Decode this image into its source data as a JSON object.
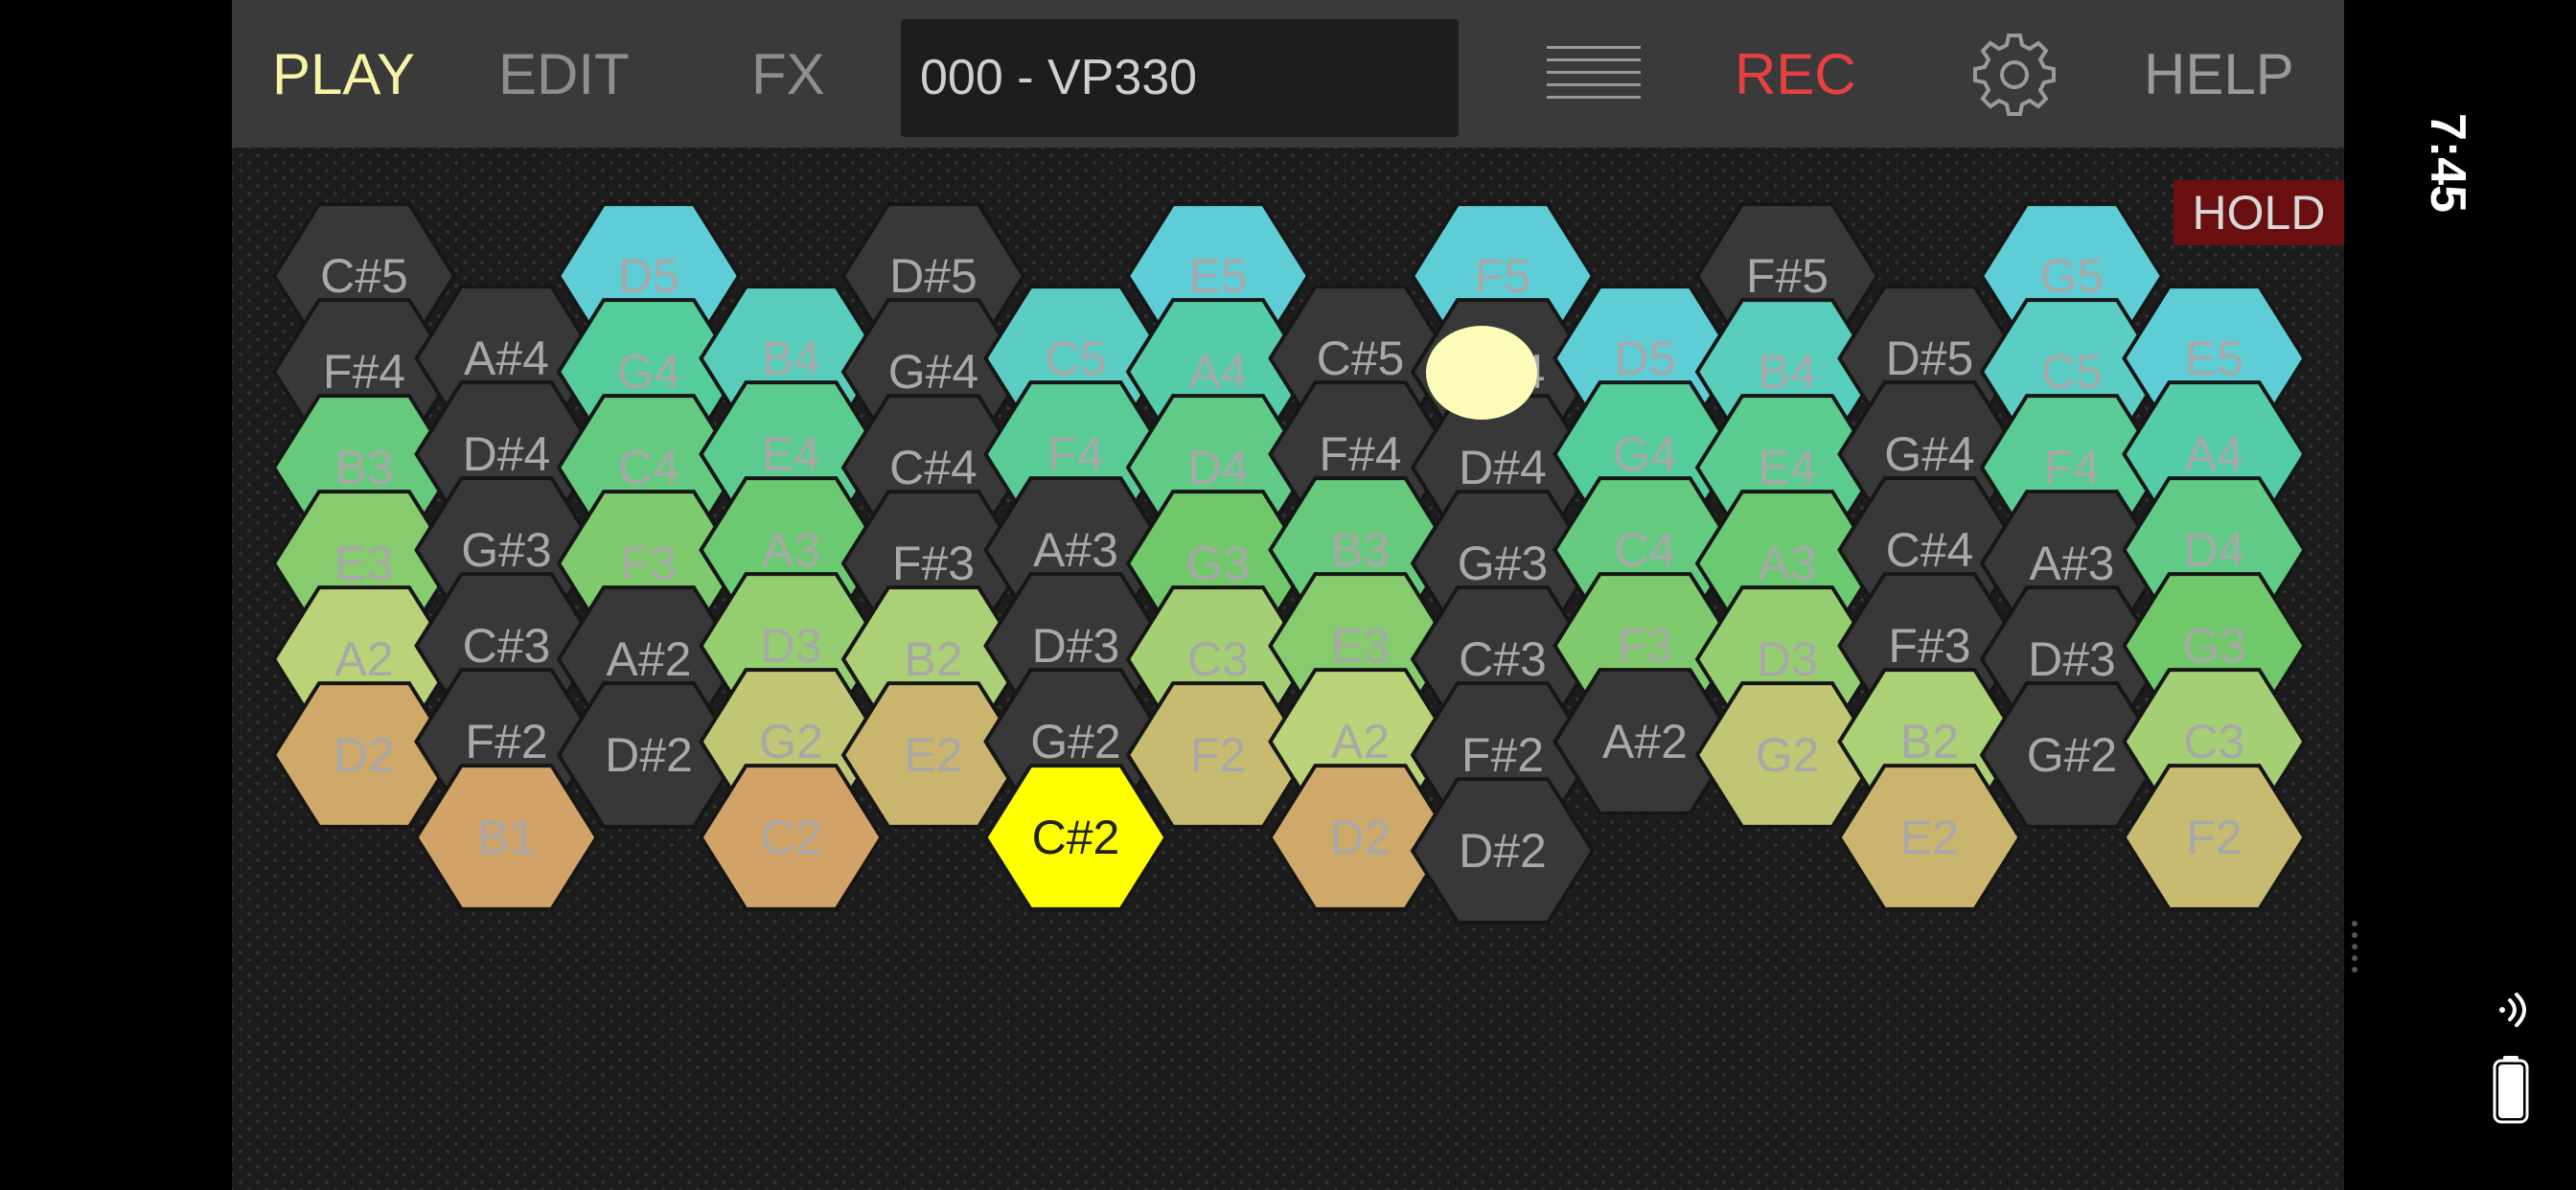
{
  "nav": {
    "play": "PLAY",
    "edit": "EDIT",
    "fx": "FX",
    "patch": "000 - VP330",
    "rec": "REC",
    "help": "HELP"
  },
  "hold": "HOLD",
  "status": {
    "time": "7:45"
  },
  "colors": {
    "active_tab": "#f8f4a6",
    "rec": "#e84040",
    "inactive": "#8e8e8e",
    "hold_bg": "#6a0f0f",
    "sharp_key": "#383838",
    "active_key": "#ffff00",
    "low_key": "#d2a368",
    "touch_indicator": "#fdfbb8"
  },
  "icons": [
    "menu-icon",
    "gear-icon",
    "wifi-icon",
    "battery-icon"
  ],
  "keyboard": {
    "columns": [
      [
        "C#5",
        "F#4",
        "B3",
        "E3",
        "A2",
        "D2"
      ],
      [
        "A#4",
        "D#4",
        "G#3",
        "C#3",
        "F#2",
        "B1"
      ],
      [
        "D5",
        "G4",
        "C4",
        "F3",
        "A#2",
        "D#2"
      ],
      [
        "B4",
        "E4",
        "A3",
        "D3",
        "G2",
        "C2"
      ],
      [
        "D#5",
        "G#4",
        "C#4",
        "F#3",
        "B2",
        "E2"
      ],
      [
        "C5",
        "F4",
        "A#3",
        "D#3",
        "G#2",
        "C#2"
      ],
      [
        "E5",
        "A4",
        "D4",
        "G3",
        "C3",
        "F2"
      ],
      [
        "C#5",
        "F#4",
        "B3",
        "E3",
        "A2",
        "D2"
      ],
      [
        "F5",
        "A#4",
        "D#4",
        "G#3",
        "C#3",
        "F#2",
        "D#2"
      ],
      [
        "D5",
        "G4",
        "C4",
        "F3",
        "A#2"
      ],
      [
        "F#5",
        "B4",
        "E4",
        "A3",
        "D3",
        "G2"
      ],
      [
        "D#5",
        "G#4",
        "C#4",
        "F#3",
        "B2",
        "E2"
      ],
      [
        "G5",
        "C5",
        "F4",
        "A#3",
        "D#3",
        "G#2"
      ],
      [
        "E5",
        "A4",
        "D4",
        "G3",
        "C3",
        "F2"
      ]
    ],
    "active_note": "C#2",
    "touch_column": 8,
    "touch_row": 1
  }
}
